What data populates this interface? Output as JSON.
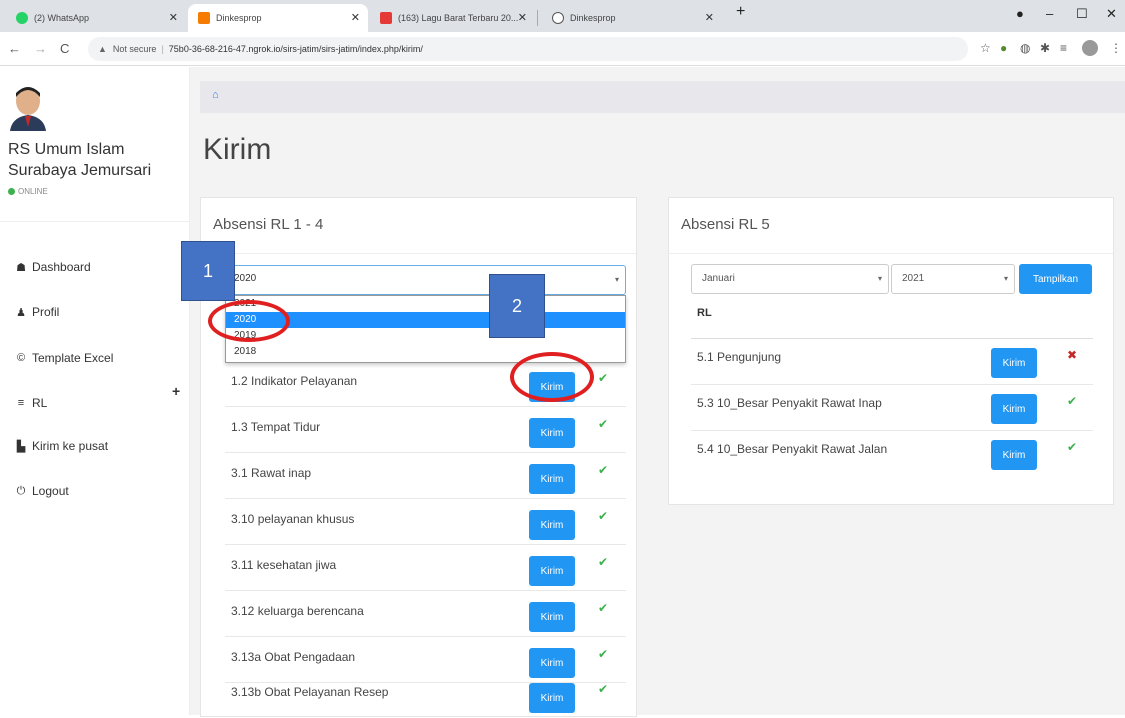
{
  "browser": {
    "tabs": [
      {
        "label": "(2) WhatsApp",
        "color": "#25d366"
      },
      {
        "label": "Dinkesprop",
        "color": "#f57c00"
      },
      {
        "label": "(163) Lagu Barat Terbaru 20...",
        "color": "#e53935"
      },
      {
        "label": "Dinkesprop",
        "color": "#555555"
      }
    ],
    "new_tab": "+",
    "url_warning": "Not secure",
    "url": "75b0-36-68-216-47.ngrok.io/sirs-jatim/sirs-jatim/index.php/kirim/"
  },
  "sidebar": {
    "hospital_name": "RS Umum Islam Surabaya Jemursari",
    "status": "ONLINE",
    "items": [
      {
        "label": "Dashboard",
        "icon": "dashboard-icon"
      },
      {
        "label": "Profil",
        "icon": "user-icon"
      },
      {
        "label": "Template Excel",
        "icon": "copyright-icon"
      },
      {
        "label": "RL",
        "icon": "list-icon"
      },
      {
        "label": "Kirim ke pusat",
        "icon": "file-icon"
      },
      {
        "label": "Logout",
        "icon": "power-icon"
      }
    ],
    "expand": "+"
  },
  "main": {
    "title": "Kirim",
    "card1": {
      "title": "Absensi RL 1 - 4",
      "selected_year": "2020",
      "year_options": [
        "2021",
        "2020",
        "2019",
        "2018"
      ],
      "highlighted_option": "2020",
      "rows": [
        {
          "label": "1.2 Indikator Pelayanan",
          "button": "Kirim",
          "status": "✔"
        },
        {
          "label": "1.3 Tempat Tidur",
          "button": "Kirim",
          "status": "✔"
        },
        {
          "label": "3.1 Rawat inap",
          "button": "Kirim",
          "status": "✔"
        },
        {
          "label": "3.10 pelayanan khusus",
          "button": "Kirim",
          "status": "✔"
        },
        {
          "label": "3.11 kesehatan jiwa",
          "button": "Kirim",
          "status": "✔"
        },
        {
          "label": "3.12 keluarga berencana",
          "button": "Kirim",
          "status": "✔"
        },
        {
          "label": "3.13a Obat Pengadaan",
          "button": "Kirim",
          "status": "✔"
        },
        {
          "label": "3.13b Obat Pelayanan Resep",
          "button": "Kirim",
          "status": "✔"
        }
      ]
    },
    "card2": {
      "title": "Absensi RL 5",
      "month": "Januari",
      "year": "2021",
      "show_button": "Tampilkan",
      "column_header": "RL",
      "rows": [
        {
          "label": "5.1 Pengunjung",
          "button": "Kirim",
          "status": "✖"
        },
        {
          "label": "5.3 10_Besar Penyakit Rawat Inap",
          "button": "Kirim",
          "status": "✔"
        },
        {
          "label": "5.4 10_Besar Penyakit Rawat Jalan",
          "button": "Kirim",
          "status": "✔"
        }
      ]
    }
  },
  "annotations": {
    "step1": "1",
    "step2": "2",
    "box_color": "#4472c4",
    "ellipse_color": "#e02020"
  },
  "colors": {
    "primary_button": "#2196f3",
    "success": "#3cb04c",
    "danger": "#c62828"
  }
}
